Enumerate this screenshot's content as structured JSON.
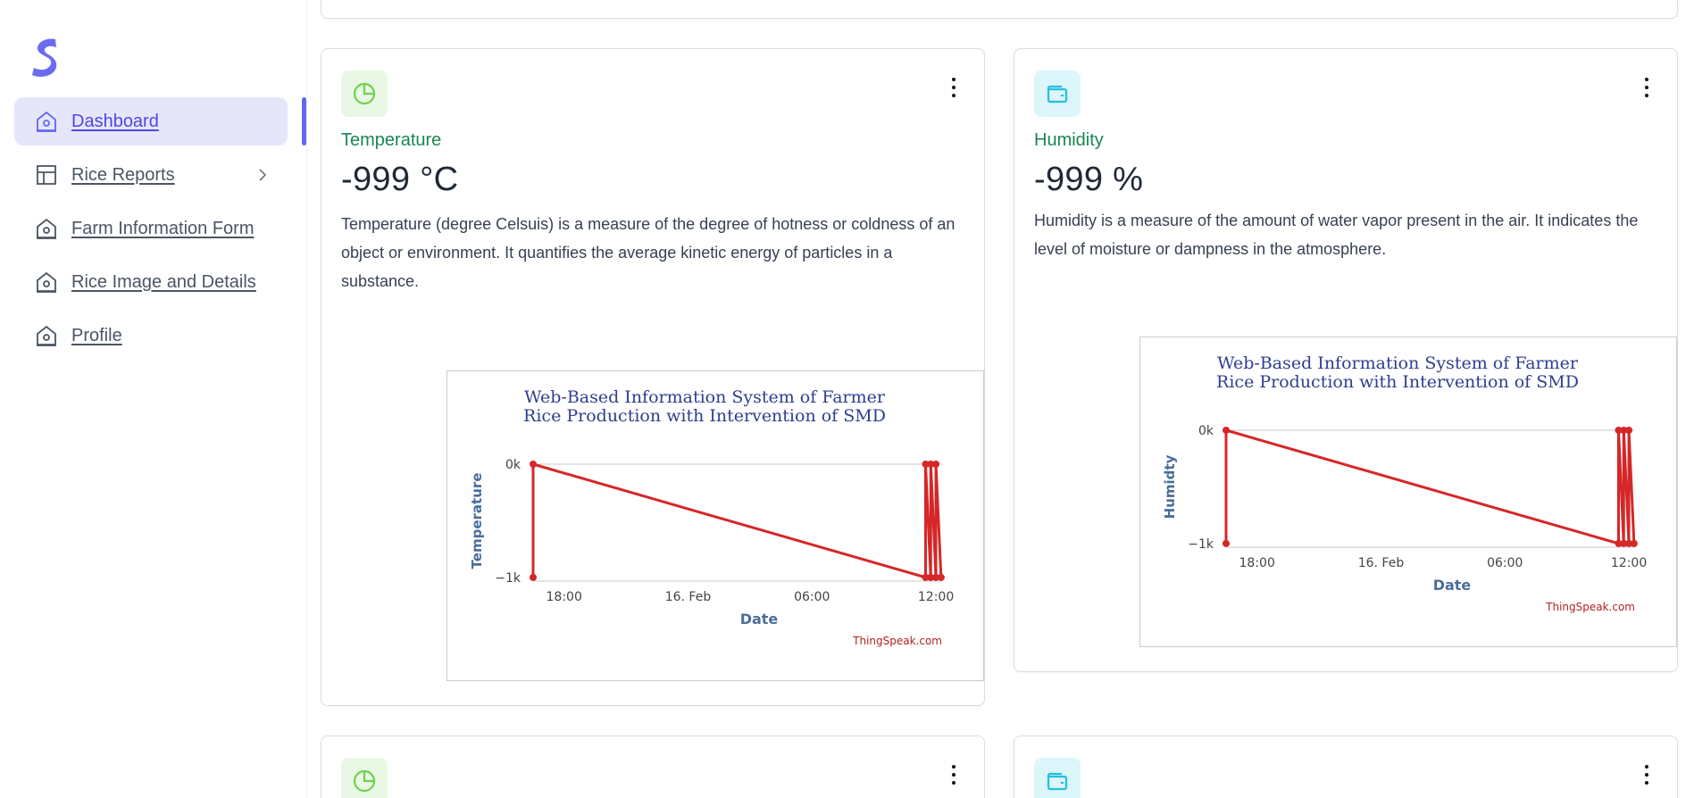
{
  "sidebar": {
    "items": [
      {
        "label": "Dashboard",
        "icon": "home-icon",
        "active": true
      },
      {
        "label": "Rice Reports",
        "icon": "layout-icon",
        "has_submenu": true
      },
      {
        "label": "Farm Information Form",
        "icon": "home-icon"
      },
      {
        "label": "Rice Image and Details",
        "icon": "home-icon"
      },
      {
        "label": "Profile",
        "icon": "home-icon"
      }
    ]
  },
  "colors": {
    "accent": "#6366f1",
    "title_green": "#198754",
    "chart_red": "#d62728",
    "chart_title": "#2f3e8f"
  },
  "cards": {
    "temperature": {
      "icon": "pie-chart-icon",
      "title": "Temperature",
      "value": "-999 °C",
      "description": "Temperature (degree Celsuis) is a measure of the degree of hotness or coldness of an object or environment. It quantifies the average kinetic energy of particles in a substance."
    },
    "humidity": {
      "icon": "wallet-icon",
      "title": "Humidity",
      "value": "-999 %",
      "description": "Humidity is a measure of the amount of water vapor present in the air. It indicates the level of moisture or dampness in the atmosphere."
    }
  },
  "chart_data": [
    {
      "type": "line",
      "title": "Web-Based Information System of Farmer Rice Production with Intervention of SMD",
      "title_lines": [
        "Web-Based Information System of Farmer",
        "Rice Production with Intervention of SMD"
      ],
      "xlabel": "Date",
      "ylabel": "Temperature",
      "x_ticks": [
        "18:00",
        "16. Feb",
        "06:00",
        "12:00"
      ],
      "y_ticks": [
        "0k",
        "−1k"
      ],
      "ylim": [
        -1000,
        0
      ],
      "credit": "ThingSpeak.com",
      "series": [
        {
          "x": [
            "15 Feb 16:30",
            "15 Feb 16:30",
            "16 Feb 11:30",
            "16 Feb 11:30",
            "16 Feb 11:45",
            "16 Feb 11:45",
            "16 Feb 12:00",
            "16 Feb 12:00",
            "16 Feb 12:15"
          ],
          "y": [
            -999,
            0,
            -999,
            0,
            -999,
            0,
            -999,
            0,
            -999
          ]
        }
      ]
    },
    {
      "type": "line",
      "title": "Web-Based Information System of Farmer Rice Production with Intervention of SMD",
      "title_lines": [
        "Web-Based Information System of Farmer",
        "Rice Production with Intervention of SMD"
      ],
      "xlabel": "Date",
      "ylabel": "Humidty",
      "x_ticks": [
        "18:00",
        "16. Feb",
        "06:00",
        "12:00"
      ],
      "y_ticks": [
        "0k",
        "−1k"
      ],
      "ylim": [
        -1000,
        0
      ],
      "credit": "ThingSpeak.com",
      "series": [
        {
          "x": [
            "15 Feb 16:30",
            "15 Feb 16:30",
            "16 Feb 11:30",
            "16 Feb 11:30",
            "16 Feb 11:45",
            "16 Feb 11:45",
            "16 Feb 12:00",
            "16 Feb 12:00",
            "16 Feb 12:15"
          ],
          "y": [
            -999,
            0,
            -999,
            0,
            -999,
            0,
            -999,
            0,
            -999
          ]
        }
      ]
    }
  ]
}
